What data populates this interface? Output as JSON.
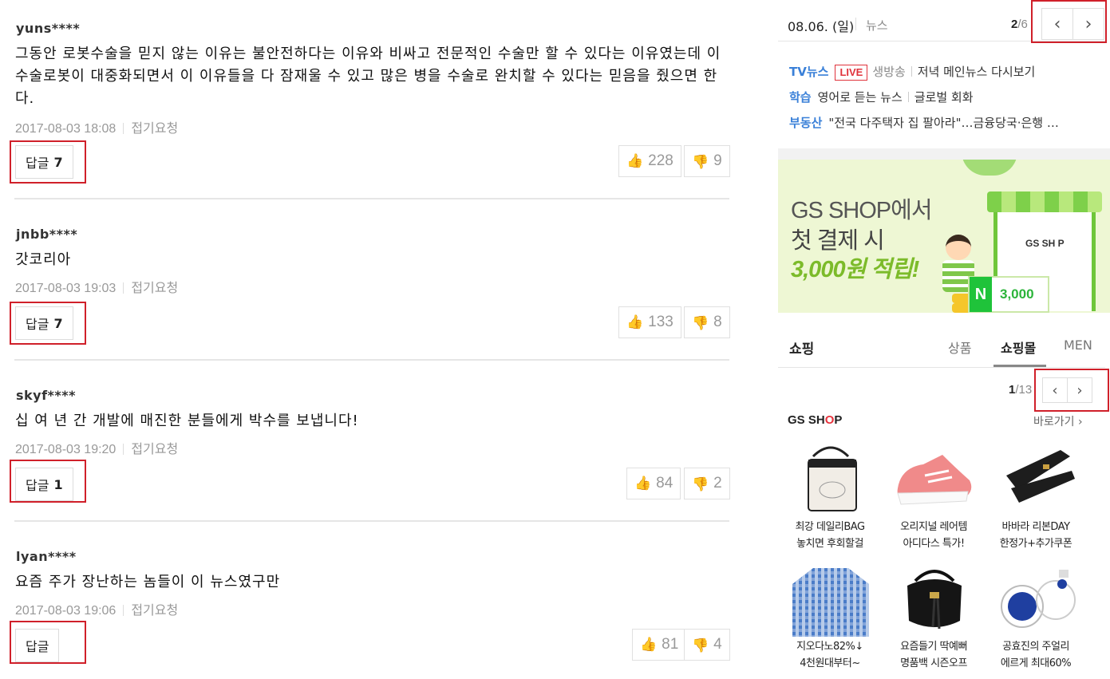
{
  "comments": [
    {
      "author": "yuns****",
      "text": "그동안 로봇수술을 믿지 않는 이유는 불안전하다는 이유와 비싸고 전문적인 수술만 할 수 있다는 이유였는데 이 수술로봇이 대중화되면서 이 이유들을 다 잠재울 수 있고 많은 병을 수술로 완치할 수 있다는 믿음을 줬으면 한다.",
      "time": "2017-08-03 18:08",
      "report": "접기요청",
      "reply_label": "답글",
      "reply_count": "7",
      "likes": "228",
      "dislikes": "9"
    },
    {
      "author": "jnbb****",
      "text": "갓코리아",
      "time": "2017-08-03 19:03",
      "report": "접기요청",
      "reply_label": "답글",
      "reply_count": "7",
      "likes": "133",
      "dislikes": "8"
    },
    {
      "author": "skyf****",
      "text": "십 여 년 간 개발에 매진한 분들에게 박수를 보냅니다!",
      "time": "2017-08-03 19:20",
      "report": "접기요청",
      "reply_label": "답글",
      "reply_count": "1",
      "likes": "84",
      "dislikes": "2"
    },
    {
      "author": "lyan****",
      "text": "요즘 주가 장난하는 놈들이 이 뉴스였구만",
      "time": "2017-08-03 19:06",
      "report": "접기요청",
      "reply_label": "답글",
      "reply_count": "",
      "likes": "81",
      "dislikes": "4"
    }
  ],
  "news": {
    "date": "08.06. (일)",
    "category": "뉴스",
    "page_current": "2",
    "page_total": "/6",
    "rows": [
      {
        "cat": "TV뉴스",
        "badge": "LIVE",
        "item1": "생방송",
        "item2": "저녁 메인뉴스 다시보기"
      },
      {
        "cat": "학습",
        "item1": "영어로 듣는 뉴스",
        "item2": "글로벌 회화"
      },
      {
        "cat": "부동산",
        "item1": "\"전국 다주택자 집 팔아라\"…금융당국·은행 …"
      }
    ]
  },
  "banner": {
    "line1": "GS SHOP에서",
    "line2": "첫 결제 시",
    "line3": "3,000원 적립!",
    "shop_logo": "GS SH P",
    "pay_icon": "N",
    "pay_amount": "3,000"
  },
  "shopping": {
    "title": "쇼핑",
    "tabs": [
      "상품",
      "쇼핑몰",
      "MEN"
    ],
    "active_tab": "쇼핑몰",
    "page_current": "1",
    "page_total": "/13",
    "store_logo_pre": "GS SH",
    "store_logo_o": "O",
    "store_logo_post": "P",
    "goto": "바로가기 ›",
    "products": [
      {
        "line1": "최강 데일리BAG",
        "line2": "놓치면 후회할걸",
        "icon": "bag-icon"
      },
      {
        "line1": "오리지널 레어템",
        "line2": "아디다스 특가!",
        "icon": "sneaker-icon"
      },
      {
        "line1": "바바라 리본DAY",
        "line2": "한정가+추가쿠폰",
        "icon": "sandal-icon"
      },
      {
        "line1": "지오다노82%↓",
        "line2": "4천원대부터~",
        "icon": "shirt-icon"
      },
      {
        "line1": "요즘들기 딱예뻐",
        "line2": "명품백 시즌오프",
        "icon": "handbag-icon"
      },
      {
        "line1": "공효진의 주얼리",
        "line2": "에르게 최대60%",
        "icon": "jewelry-icon"
      }
    ]
  },
  "colors": {
    "accent_red": "#d0202a",
    "news_blue": "#3a80d8",
    "live_red": "#e0333c",
    "brand_green": "#7cbb2a"
  }
}
